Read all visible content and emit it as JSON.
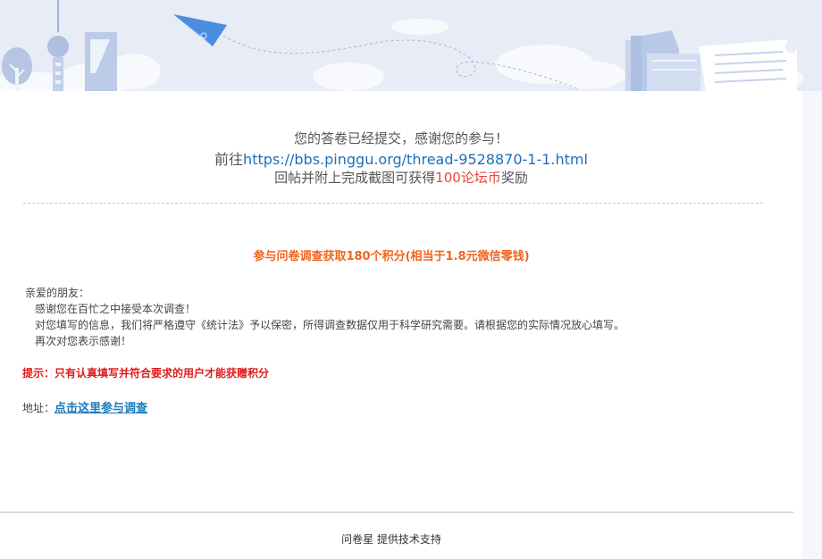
{
  "confirmation": {
    "line1": "您的答卷已经提交，感谢您的参与！",
    "line2_prefix": "前往",
    "line2_url": "https://bbs.pinggu.org/thread-9528870-1-1.html",
    "line3_prefix": "回帖并附上完成截图可获得",
    "line3_reward": "100论坛币",
    "line3_suffix": "奖励"
  },
  "headline": "参与问卷调查获取180个积分(相当于1.8元微信零钱)",
  "intro": {
    "greeting": "亲爱的朋友：",
    "lines": [
      "感谢您在百忙之中接受本次调查！",
      "对您填写的信息，我们将严格遵守《统计法》予以保密，所得调查数据仅用于科学研究需要。请根据您的实际情况放心填写。",
      "再次对您表示感谢！"
    ]
  },
  "tip": "提示：只有认真填写并符合要求的用户才能获赠积分",
  "address": {
    "label": "地址：",
    "link_text": "点击这里参与调查"
  },
  "footer": {
    "brand": "问卷星",
    "text": " 提供技术支持"
  },
  "colors": {
    "accent_orange": "#f0641e",
    "tip_red": "#e01b1b",
    "reward_red": "#e8453c",
    "link_blue": "#1a7ab8"
  }
}
